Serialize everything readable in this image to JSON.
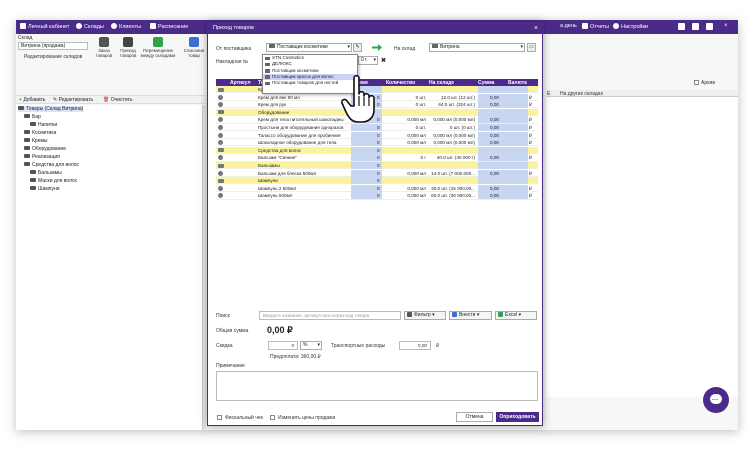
{
  "topbar": {
    "personal": "Личный кабинет",
    "warehouses": "Склады",
    "clients": "Клиенты",
    "schedule": "Расписание",
    "day_suffix": "а день",
    "reports": "Отчеты",
    "settings": "Настройки",
    "accent": "#4b2b8a"
  },
  "bg_left": {
    "warehouse_label": "Склад",
    "warehouse_value": "Витрина (продажа)",
    "edit_warehouses": "Редактирование складов",
    "tools": [
      {
        "label": "Заказ товаров"
      },
      {
        "label": "Приход товаров"
      },
      {
        "label": "Перемещение между складами"
      },
      {
        "label": "Списание товар"
      }
    ],
    "actions": {
      "add": "Добавить",
      "edit": "Редактировать",
      "clear": "Очистить"
    },
    "tree": [
      {
        "label": "Товары (Склад Витрина)"
      },
      {
        "label": "Бар"
      },
      {
        "label": "Напитки"
      },
      {
        "label": "Косметика"
      },
      {
        "label": "Кремы"
      },
      {
        "label": "Оборудование"
      },
      {
        "label": "Реализация"
      },
      {
        "label": "Средства для волос"
      },
      {
        "label": "Бальзамы"
      },
      {
        "label": "Маски для волос"
      },
      {
        "label": "Шампуни"
      }
    ]
  },
  "bg_right": {
    "archive": "Архив",
    "other_warehouses": "На других складах",
    "col_e": "Е"
  },
  "modal": {
    "title": "Приход товаров",
    "close": "×",
    "from_supplier_label": "От поставщика",
    "supplier_value": "Поставщик косметики",
    "to_warehouse_label": "На склад",
    "warehouse_value": "Витрина",
    "invoice_label": "Накладная №",
    "date_fragment": "0 г.",
    "dropdown_options": [
      "STN Cosmetics",
      "ДЕЛЮКС",
      "Поставщик косметики",
      "Поставщик красок для волос",
      "Поставщик товаров для ногтей"
    ],
    "columns": {
      "article": "Артикул",
      "name": "То",
      "price": "овая",
      "qty": "Количество",
      "stock": "На складе",
      "sum": "Сумма",
      "currency": "Валюта"
    },
    "rows": [
      {
        "type": "cat",
        "name": "Крем",
        "price": "",
        "qty": "",
        "stock": "",
        "sum": "",
        "cur": ""
      },
      {
        "type": "item",
        "name": "Крем для век 50 мл",
        "price": "0",
        "qty": "0 шт.",
        "stock": "12.0 шт. (12 шт.)",
        "sum": "0,00",
        "cur": "₽"
      },
      {
        "type": "item",
        "name": "Крем для рук",
        "price": "0",
        "qty": "0 шт.",
        "stock": "64.0 шт. (324 шт.)",
        "sum": "0,00",
        "cur": "₽"
      },
      {
        "type": "cat",
        "name": "Оборудование",
        "price": "",
        "qty": "",
        "stock": "",
        "sum": "",
        "cur": ""
      },
      {
        "type": "item",
        "name": "Крем для тела питательный шоколадны",
        "price": "0",
        "qty": "0,000 мл",
        "stock": "0,000 мл (0,000 мл)",
        "sum": "0,00",
        "cur": "₽"
      },
      {
        "type": "item",
        "name": "Простыни для оборудования одноразов",
        "price": "0",
        "qty": "0 шт.",
        "stock": "0 шт. (0 шт.)",
        "sum": "0,00",
        "cur": "₽"
      },
      {
        "type": "item",
        "name": "Талассо оборудование для пробиения",
        "price": "0",
        "qty": "0,000 мл",
        "stock": "0,000 мл (0,000 мл)",
        "sum": "0,00",
        "cur": "₽"
      },
      {
        "type": "item",
        "name": "Шоколадное оборудование для тела",
        "price": "0",
        "qty": "0,000 мл",
        "stock": "0,000 мл (0,000 мл)",
        "sum": "0,00",
        "cur": "₽"
      },
      {
        "type": "cat",
        "name": "Средства для волос",
        "price": "0",
        "qty": "",
        "stock": "",
        "sum": "",
        "cur": ""
      },
      {
        "type": "item",
        "name": "Бальзам \"Сияние\"",
        "price": "0",
        "qty": "0 г",
        "stock": "40.0 шт. (40 000 г)",
        "sum": "0,00",
        "cur": "₽"
      },
      {
        "type": "cat",
        "name": "Бальзамы",
        "price": "0",
        "qty": "",
        "stock": "",
        "sum": "",
        "cur": ""
      },
      {
        "type": "item",
        "name": "Бальзам для блеска 500мл",
        "price": "0",
        "qty": "0,000 мл",
        "stock": "14.0 шт. (7 000.000...",
        "sum": "0,00",
        "cur": "₽"
      },
      {
        "type": "cat",
        "name": "Шампуни",
        "price": "0",
        "qty": "",
        "stock": "",
        "sum": "",
        "cur": ""
      },
      {
        "type": "item",
        "name": "Шампунь 2 500мл",
        "price": "0",
        "qty": "0,000 мл",
        "stock": "30.0 шт. (15 000.00...",
        "sum": "0,00",
        "cur": "₽"
      },
      {
        "type": "item",
        "name": "Шампунь 500мл",
        "price": "0",
        "qty": "0,000 мл",
        "stock": "60.0 шт. (30 000.00...",
        "sum": "0,00",
        "cur": "₽"
      }
    ],
    "search_label": "Поиск",
    "search_placeholder": "Введите название, артикул или штрих-код товара",
    "filter": "Фильтр",
    "add": "Внести",
    "excel": "Excel",
    "total_label": "Общая сумма",
    "total_value": "0,00 ₽",
    "discount_label": "Скидка",
    "discount_value": "0",
    "discount_unit": "%",
    "transport_label": "Транспортные расходы",
    "transport_value": "0,00",
    "transport_cur": "₽",
    "prepay": "Предоплата: 360,00 ₽",
    "notes_label": "Примечание",
    "fiscal": "Фискальный чек",
    "change_prices": "Изменить цены продажи",
    "cancel": "Отмена",
    "submit": "Оприходовать"
  }
}
